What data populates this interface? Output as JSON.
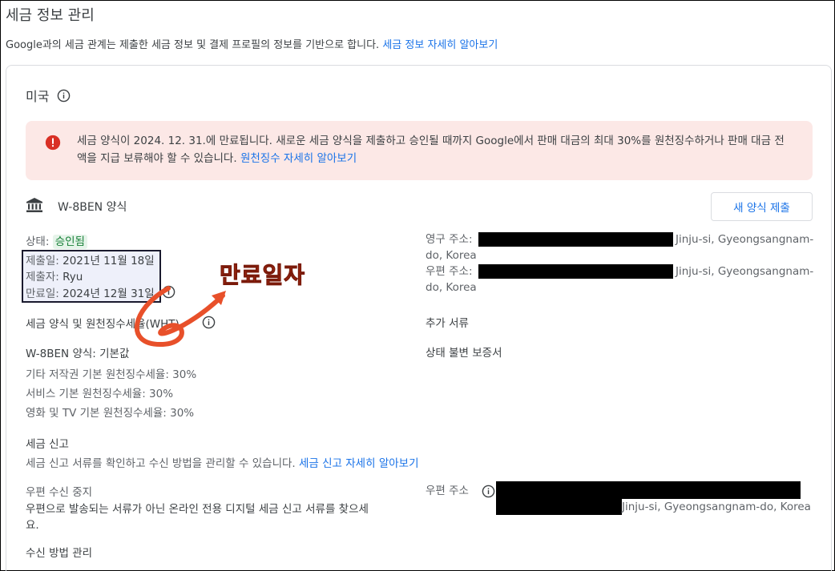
{
  "header": {
    "title": "세금 정보 관리",
    "description": "Google과의 세금 관계는 제출한 세금 정보 및 결제 프로필의 정보를 기반으로 합니다.",
    "learn_more_link": "세금 정보 자세히 알아보기"
  },
  "country": {
    "name": "미국"
  },
  "alert": {
    "text": "세금 양식이 2024. 12. 31.에 만료됩니다. 새로운 세금 양식을 제출하고 승인될 때까지 Google에서 판매 대금의 최대 30%를 원천징수하거나 판매 대금 전액을 지급 보류해야 할 수 있습니다.",
    "link": "원천징수 자세히 알아보기"
  },
  "form": {
    "name": "W-8BEN 양식",
    "new_form_button": "새 양식 제출",
    "status_label": "상태:",
    "status_value": "승인됨",
    "submitted_label": "제출일:",
    "submitted_value": "2021년 11월 18일",
    "submitter_label": "제출자:",
    "submitter_value": "Ryu",
    "expiry_label": "만료일:",
    "expiry_value": "2024년 12월 31일"
  },
  "annotation": {
    "text": "만료일자"
  },
  "address": {
    "permanent_label": "영구 주소:",
    "permanent_tail": "Jinju-si, Gyeongsangnam-",
    "permanent_tail2": "do, Korea",
    "mailing_label": "우편 주소:",
    "mailing_tail": "Jinju-si, Gyeongsangnam-",
    "mailing_tail2": "do, Korea"
  },
  "withholding": {
    "title": "세금 양식 및 원천징수세율(WHT)",
    "form_link": "W-8BEN 양식: 기본값",
    "rates": [
      "기타 저작권 기본 원천징수세율: 30%",
      "서비스 기본 원천징수세율: 30%",
      "영화 및 TV 기본 원천징수세율: 30%"
    ]
  },
  "additional_docs": {
    "title": "추가 서류",
    "link": "상태 불변 보증서"
  },
  "tax_reporting": {
    "title": "세금 신고",
    "description": "세금 신고 서류를 확인하고 수신 방법을 관리할 수 있습니다.",
    "link": "세금 신고 자세히 알아보기"
  },
  "paper_stop": {
    "title": "우편 수신 중지",
    "description_line1": "우편으로 발송되는 서류가 아닌 온라인 전용 디지털 세금 신고 서류를 찾으세",
    "description_line2": "요.",
    "manage_link": "수신 방법 관리"
  },
  "postal": {
    "label": "우편 주소",
    "tail": "Jinju-si, Gyeongsangnam-do, Korea"
  },
  "colors": {
    "link": "#1a73e8",
    "alert_bg": "#fce8e6",
    "alert_icon": "#d93025",
    "approved": "#188038",
    "annotation": "#d93b1a"
  },
  "icons": [
    "info-icon",
    "error-icon",
    "bank-icon"
  ]
}
